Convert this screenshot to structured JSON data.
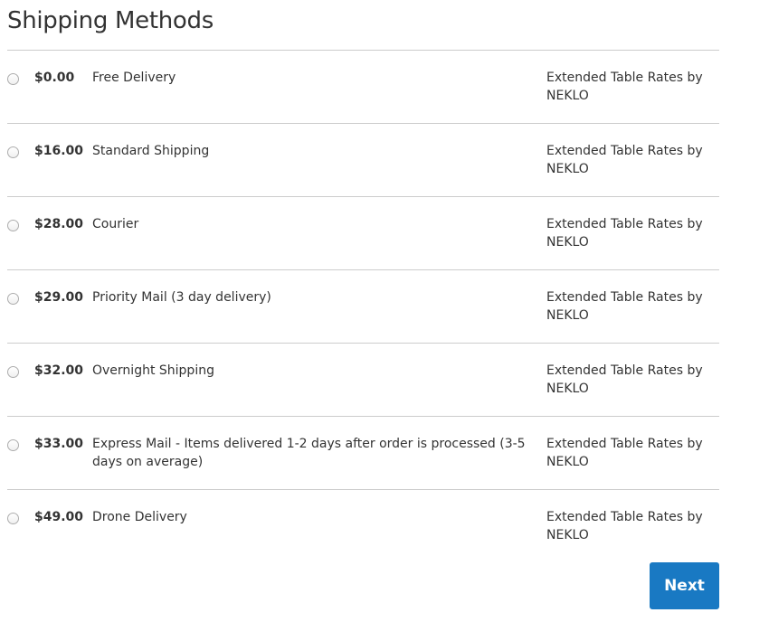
{
  "header": {
    "title": "Shipping Methods"
  },
  "methods": [
    {
      "price": "$0.00",
      "name": "Free Delivery",
      "carrier": "Extended Table Rates by NEKLO"
    },
    {
      "price": "$16.00",
      "name": "Standard Shipping",
      "carrier": "Extended Table Rates by NEKLO"
    },
    {
      "price": "$28.00",
      "name": "Courier",
      "carrier": "Extended Table Rates by NEKLO"
    },
    {
      "price": "$29.00",
      "name": "Priority Mail (3 day delivery)",
      "carrier": "Extended Table Rates by NEKLO"
    },
    {
      "price": "$32.00",
      "name": "Overnight Shipping",
      "carrier": "Extended Table Rates by NEKLO"
    },
    {
      "price": "$33.00",
      "name": "Express Mail - Items delivered 1-2 days after order is processed (3-5 days on average)",
      "carrier": "Extended Table Rates by NEKLO"
    },
    {
      "price": "$49.00",
      "name": "Drone Delivery",
      "carrier": "Extended Table Rates by NEKLO"
    }
  ],
  "actions": {
    "next_label": "Next"
  },
  "colors": {
    "primary_button": "#1979c3",
    "divider": "#cccccc",
    "text": "#333333"
  }
}
